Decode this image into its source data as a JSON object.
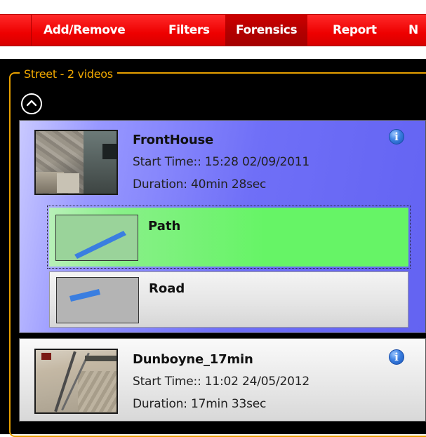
{
  "menubar": {
    "items": [
      {
        "label": "Add/Remove",
        "active": false
      },
      {
        "label": "Filters",
        "active": false
      },
      {
        "label": "Forensics",
        "active": true
      },
      {
        "label": "Report",
        "active": false
      },
      {
        "label": "N",
        "active": false
      }
    ]
  },
  "group": {
    "title": "Street - 2 videos",
    "collapse_icon": "chevron-up-circle-icon"
  },
  "videos": [
    {
      "name": "FrontHouse",
      "start_time": "Start Time:: 15:28 02/09/2011",
      "duration": "Duration: 40min 28sec",
      "selected": true,
      "info_icon": "info-icon",
      "regions": [
        {
          "label": "Path",
          "selected": true
        },
        {
          "label": "Road",
          "selected": false
        }
      ]
    },
    {
      "name": "Dunboyne_17min",
      "start_time": "Start Time:: 11:02 24/05/2012",
      "duration": "Duration: 17min 33sec",
      "selected": false,
      "info_icon": "info-icon",
      "regions": []
    }
  ],
  "colors": {
    "menubar": "#ee0000",
    "menubar_active": "#b00000",
    "group_border": "#e8a000",
    "selected_card": "#6f6ff7",
    "path_region": "#66f466",
    "region_shape": "#3a7ee0"
  }
}
